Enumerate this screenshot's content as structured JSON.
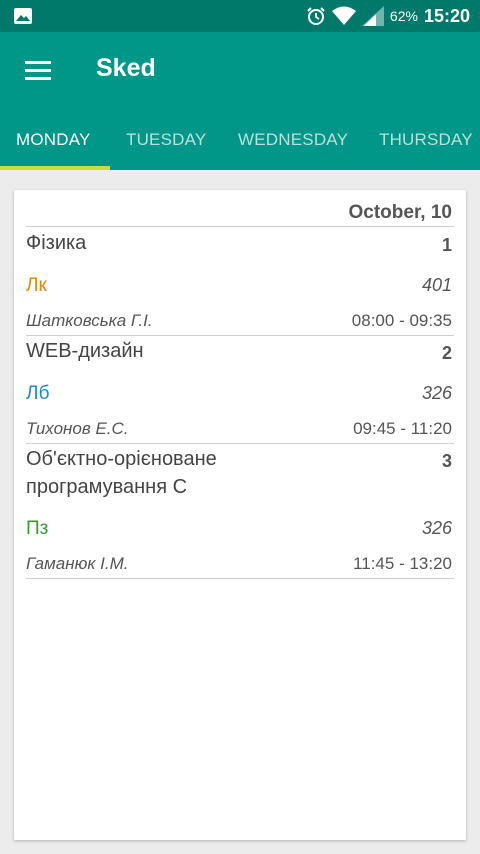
{
  "status_bar": {
    "battery": "62%",
    "time": "15:20",
    "icons": [
      "image-icon",
      "alarm-icon",
      "wifi-icon",
      "signal-icon",
      "battery-icon"
    ]
  },
  "app_bar": {
    "title": "Sked",
    "menu_icon": "hamburger-menu-icon"
  },
  "tabs": [
    {
      "label": "MONDAY",
      "active": true
    },
    {
      "label": "TUESDAY",
      "active": false
    },
    {
      "label": "WEDNESDAY",
      "active": false
    },
    {
      "label": "THURSDAY",
      "active": false
    }
  ],
  "schedule": {
    "date": "October, 10",
    "lessons": [
      {
        "subject": "Фізика",
        "number": "1",
        "type": "Лк",
        "type_color": "#e08a00",
        "room": "401",
        "teacher": "Шатковська Г.І.",
        "time": "08:00 - 09:35"
      },
      {
        "subject": "WEB-дизайн",
        "number": "2",
        "type": "Лб",
        "type_color": "#1e88c8",
        "room": "326",
        "teacher": "Тихонов Е.С.",
        "time": "09:45 - 11:20"
      },
      {
        "subject": "Об'єктно-орієноване програмування С",
        "number": "3",
        "type": "Пз",
        "type_color": "#2e9e2e",
        "room": "326",
        "teacher": "Гаманюк І.М.",
        "time": "11:45 - 13:20"
      }
    ]
  },
  "colors": {
    "status_bar": "#00796b",
    "primary": "#009688",
    "tab_indicator": "#cddc39"
  }
}
